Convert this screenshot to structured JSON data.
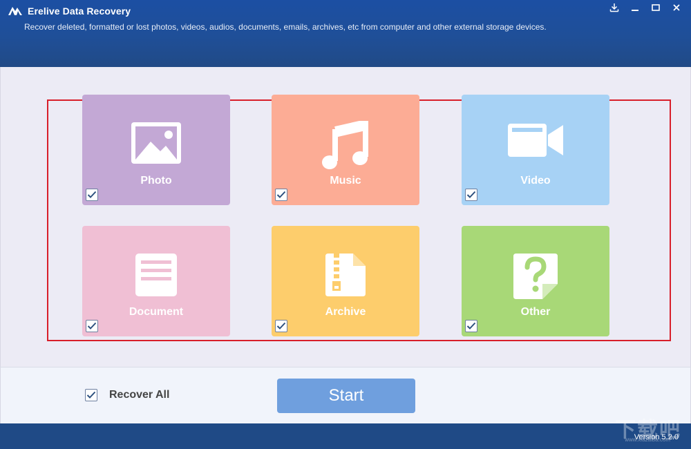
{
  "window": {
    "title": "Erelive Data Recovery",
    "subtitle": "Recover deleted, formatted or lost photos, videos, audios, documents, emails, archives, etc from computer and other external storage devices.",
    "controls": [
      "download-icon",
      "minimize-icon",
      "maximize-icon",
      "close-icon"
    ]
  },
  "categories": [
    {
      "id": "photo",
      "label": "Photo",
      "color": "#c3a8d5",
      "icon": "image-icon",
      "checked": true
    },
    {
      "id": "music",
      "label": "Music",
      "color": "#fcac95",
      "icon": "music-note-icon",
      "checked": true
    },
    {
      "id": "video",
      "label": "Video",
      "color": "#a7d2f5",
      "icon": "video-camera-icon",
      "checked": true
    },
    {
      "id": "document",
      "label": "Document",
      "color": "#f0bfd4",
      "icon": "document-icon",
      "checked": true
    },
    {
      "id": "archive",
      "label": "Archive",
      "color": "#fdcd6c",
      "icon": "zip-archive-icon",
      "checked": true
    },
    {
      "id": "other",
      "label": "Other",
      "color": "#a8d877",
      "icon": "question-file-icon",
      "checked": true
    }
  ],
  "bottom": {
    "recover_all_label": "Recover All",
    "recover_all_checked": true,
    "start_label": "Start"
  },
  "footer": {
    "version": "Version 5.2.0",
    "watermark": "下载吧",
    "watermark_url": "www.xiazaiba.com"
  },
  "colors": {
    "header": "#1f4f98",
    "highlight_frame": "#d81e2a",
    "start_button": "#6f9fde"
  }
}
